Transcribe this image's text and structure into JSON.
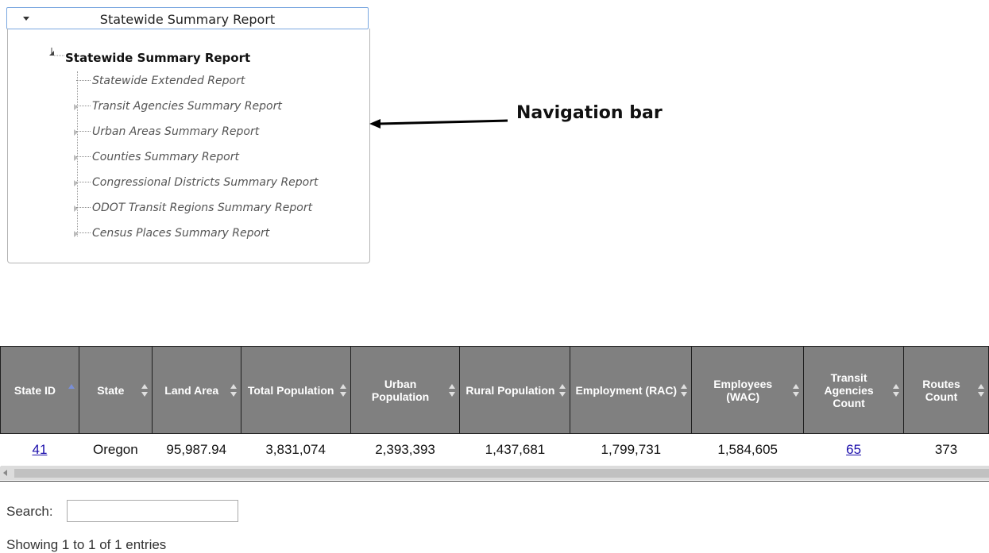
{
  "dropdown": {
    "title": "Statewide Summary Report"
  },
  "tree": {
    "root_label": "Statewide Summary Report",
    "items": [
      "Statewide Extended Report",
      "Transit Agencies Summary Report",
      "Urban Areas Summary Report",
      "Counties Summary Report",
      "Congressional Districts Summary Report",
      "ODOT Transit Regions Summary Report",
      "Census Places Summary Report"
    ]
  },
  "annotation": {
    "label": "Navigation bar"
  },
  "table": {
    "headers": [
      {
        "label": "State ID",
        "sort": "asc"
      },
      {
        "label": "State",
        "sort": "none"
      },
      {
        "label": "Land Area",
        "sort": "none"
      },
      {
        "label": "Total Population",
        "sort": "none"
      },
      {
        "label": "Urban Population",
        "sort": "none"
      },
      {
        "label": "Rural Population",
        "sort": "none"
      },
      {
        "label": "Employment (RAC)",
        "sort": "none"
      },
      {
        "label": "Employees (WAC)",
        "sort": "none"
      },
      {
        "label": "Transit Agencies Count",
        "sort": "none"
      },
      {
        "label": "Routes Count",
        "sort": "none"
      }
    ],
    "rows": [
      [
        "41",
        "Oregon",
        "95,987.94",
        "3,831,074",
        "2,393,393",
        "1,437,681",
        "1,799,731",
        "1,584,605",
        "65",
        "373"
      ]
    ],
    "link_columns": [
      0,
      8
    ]
  },
  "search": {
    "label": "Search:",
    "value": "",
    "placeholder": ""
  },
  "info": {
    "text": "Showing 1 to 1 of 1 entries"
  },
  "colors": {
    "header_bg": "#808080",
    "link": "#1a0dab",
    "dropdown_border": "#7aa7e0"
  }
}
